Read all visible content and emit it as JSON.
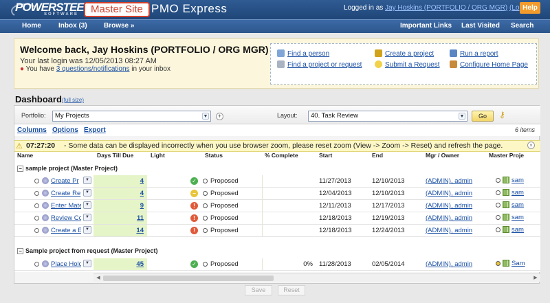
{
  "header": {
    "logo_text": "POWERSTEERING",
    "logo_sub": "SOFTWARE",
    "master_site": "Master Site",
    "app_name": "PMO Express",
    "logged_in_prefix": "Logged in as",
    "user": "Jay Hoskins (PORTFOLIO / ORG MGR)",
    "logout": "(Log out)",
    "help": "Help"
  },
  "nav": {
    "home": "Home",
    "inbox": "Inbox (3)",
    "browse": "Browse »",
    "important_links": "Important Links",
    "last_visited": "Last Visited",
    "search": "Search"
  },
  "welcome": {
    "title": "Welcome back, Jay Hoskins (PORTFOLIO / ORG MGR)",
    "last_login": "Your last login was 12/05/2013 08:27 AM",
    "notif_prefix": "You have",
    "notif_link": "3 questions/notifications",
    "notif_suffix": "in your inbox"
  },
  "quick_links": {
    "find_person": "Find a person",
    "find_project": "Find a project or request",
    "create_project": "Create a project",
    "submit_request": "Submit a Request",
    "run_report": "Run a report",
    "configure_home": "Configure Home Page"
  },
  "dashboard": {
    "title": "Dashboard",
    "full_size": "(full size)",
    "portfolio_label": "Portfolio:",
    "portfolio_value": "My Projects",
    "layout_label": "Layout:",
    "layout_value": "40. Task Review",
    "go": "Go",
    "columns": "Columns",
    "options": "Options",
    "export": "Export",
    "items_count": "6 items"
  },
  "alert": {
    "time": "07:27:20",
    "message": "- Some data can be displayed incorrectly when you use browser zoom, please reset zoom (View -> Zoom -> Reset) and refresh the page."
  },
  "columns": {
    "name": "Name",
    "days": "Days Till Due",
    "light": "Light",
    "status": "Status",
    "pct": "% Complete",
    "start": "Start",
    "end": "End",
    "mgr": "Mgr / Owner",
    "master": "Master Proje"
  },
  "groups": [
    {
      "label": "sample project (Master Project)",
      "rows": [
        {
          "name": "Create Pr",
          "days": "4",
          "light": "green",
          "status": "Proposed",
          "pct": "",
          "start": "11/27/2013",
          "end": "12/10/2013",
          "mgr": "(ADMIN), admin",
          "master": "sam"
        },
        {
          "name": "Create Re",
          "days": "4",
          "light": "yellow",
          "status": "Proposed",
          "pct": "",
          "start": "12/04/2013",
          "end": "12/10/2013",
          "mgr": "(ADMIN), admin",
          "master": "sam"
        },
        {
          "name": "Enter Mate",
          "days": "9",
          "light": "red",
          "status": "Proposed",
          "pct": "",
          "start": "12/11/2013",
          "end": "12/17/2013",
          "mgr": "(ADMIN), admin",
          "master": "sam"
        },
        {
          "name": "Review Co",
          "days": "11",
          "light": "red",
          "status": "Proposed",
          "pct": "",
          "start": "12/18/2013",
          "end": "12/19/2013",
          "mgr": "(ADMIN), admin",
          "master": "sam"
        },
        {
          "name": "Create a E",
          "days": "14",
          "light": "red",
          "status": "Proposed",
          "pct": "",
          "start": "12/18/2013",
          "end": "12/24/2013",
          "mgr": "(ADMIN), admin",
          "master": "sam"
        }
      ]
    },
    {
      "label": "Sample project from request (Master Project)",
      "rows": [
        {
          "name": "Place Hold",
          "days": "45",
          "light": "green",
          "status": "Proposed",
          "pct": "0%",
          "start": "11/28/2013",
          "end": "02/05/2014",
          "mgr": "(ADMIN), admin",
          "master": "Sam"
        }
      ]
    }
  ],
  "footer": {
    "save": "Save",
    "reset": "Reset"
  },
  "colors": {
    "header": "#1f4678",
    "accent": "#d2402a",
    "help": "#f29b2c",
    "light_green": "#4caf50",
    "light_yellow": "#e9c53a",
    "light_red": "#e05a3a"
  }
}
